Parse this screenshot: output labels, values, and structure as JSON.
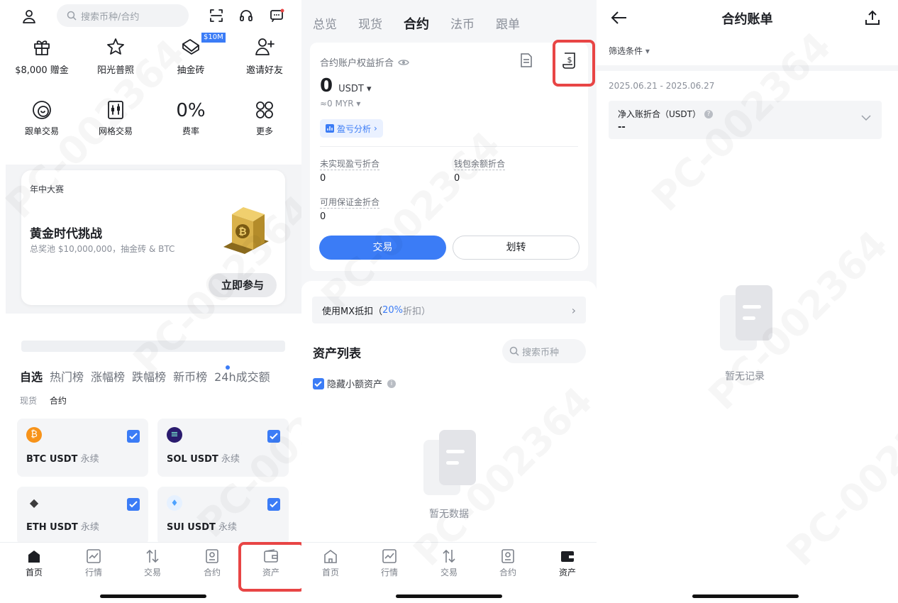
{
  "home": {
    "search_placeholder": "搜索币种/合约",
    "quick_row1": [
      {
        "label": "$8,000 赠金",
        "icon": "gift-icon"
      },
      {
        "label": "阳光普照",
        "icon": "sun-star-icon"
      },
      {
        "label": "抽金砖",
        "icon": "gold-brick-icon",
        "badge": "$10M"
      },
      {
        "label": "邀请好友",
        "icon": "invite-user-icon"
      }
    ],
    "quick_row2": [
      {
        "label": "跟单交易",
        "icon": "copy-trade-icon"
      },
      {
        "label": "网格交易",
        "icon": "grid-trade-icon"
      },
      {
        "label": "费率",
        "icon": "fee-rate-icon",
        "glyph": "0%"
      },
      {
        "label": "更多",
        "icon": "more-icon"
      }
    ],
    "banner": {
      "tag": "年中大赛",
      "title": "黄金时代挑战",
      "subtitle": "总奖池 $10,000,000，抽金砖 & BTC",
      "cta": "立即参与"
    },
    "market_tabs": [
      "自选",
      "热门榜",
      "涨幅榜",
      "跌幅榜",
      "新币榜",
      "24h成交额"
    ],
    "sub_tabs": [
      "现货",
      "合约"
    ],
    "favorites": [
      {
        "pair": "BTC USDT",
        "suffix": "永续",
        "coin": "btc",
        "color": "#f7931a",
        "glyph": "₿"
      },
      {
        "pair": "SOL USDT",
        "suffix": "永续",
        "coin": "sol",
        "color": "#2a1b6e",
        "glyph": "≡"
      },
      {
        "pair": "ETH USDT",
        "suffix": "永续",
        "coin": "eth",
        "color": "#3c3c3d",
        "glyph": "◆"
      },
      {
        "pair": "SUI USDT",
        "suffix": "永续",
        "coin": "sui",
        "color": "#4da2ff",
        "glyph": "♦"
      }
    ],
    "nav": [
      "首页",
      "行情",
      "交易",
      "合约",
      "资产"
    ]
  },
  "assets": {
    "tabs": [
      "总览",
      "现货",
      "合约",
      "法币",
      "跟单"
    ],
    "active_tab": "合约",
    "equity_label": "合约账户权益折合",
    "equity_value": "0",
    "equity_unit": "USDT",
    "equity_fiat": "≈0 MYR",
    "pnl_link": "盈亏分析",
    "unrealized_label": "未实现盈亏折合",
    "unrealized_value": "0",
    "wallet_label": "钱包余额折合",
    "wallet_value": "0",
    "margin_label": "可用保证金折合",
    "margin_value": "0",
    "trade_btn": "交易",
    "transfer_btn": "划转",
    "mx_prefix": "使用MX抵扣（",
    "mx_percent": "20%",
    "mx_suffix": "折扣）",
    "list_title": "资产列表",
    "search_placeholder": "搜索币种",
    "hide_small": "隐藏小额资产",
    "empty": "暂无数据",
    "nav": [
      "首页",
      "行情",
      "交易",
      "合约",
      "资产"
    ]
  },
  "bill": {
    "title": "合约账单",
    "filter": "筛选条件",
    "date_range": "2025.06.21 - 2025.06.27",
    "net_label": "净入账折合（USDT）",
    "net_value": "--",
    "empty": "暂无记录"
  },
  "watermark": "PC-002364",
  "colors": {
    "primary": "#3b7cf6",
    "highlight": "#e84545",
    "text": "#1d1f24",
    "muted": "#8a8f99"
  }
}
